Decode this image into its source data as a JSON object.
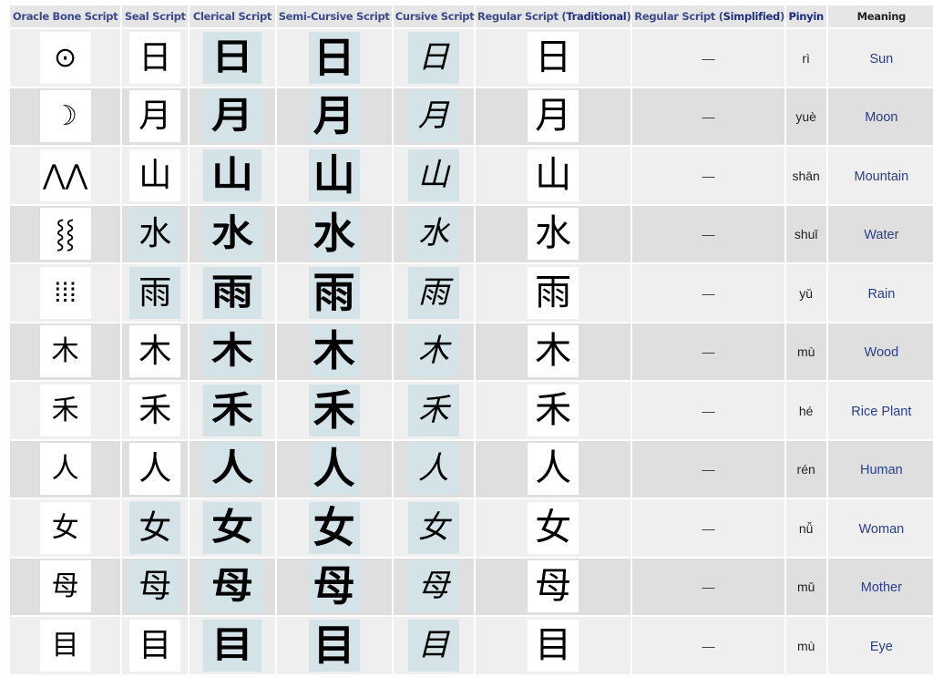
{
  "table": {
    "headers": [
      {
        "text": "Oracle Bone Script"
      },
      {
        "text": "Seal Script"
      },
      {
        "text": "Clerical Script"
      },
      {
        "text": "Semi-Cursive Script"
      },
      {
        "text": "Cursive Script"
      },
      {
        "prefix": "Regular Script (",
        "accent": "Traditional",
        "suffix": ")"
      },
      {
        "prefix": "Regular Script (",
        "accent": "Simplified",
        "suffix": ")"
      },
      {
        "text": "Pinyin"
      },
      {
        "text": "Meaning"
      }
    ],
    "rows": [
      {
        "oracle": "⊙",
        "seal": "日",
        "clerical": "日",
        "semi": "日",
        "cursive": "日",
        "traditional": "日",
        "simplified": "—",
        "pinyin": "rì",
        "meaning": "Sun",
        "seal_bg": "white"
      },
      {
        "oracle": "☽",
        "seal": "月",
        "clerical": "月",
        "semi": "月",
        "cursive": "月",
        "traditional": "月",
        "simplified": "—",
        "pinyin": "yuè",
        "meaning": "Moon",
        "seal_bg": "white"
      },
      {
        "oracle": "⋀⋀",
        "seal": "山",
        "clerical": "山",
        "semi": "山",
        "cursive": "山",
        "traditional": "山",
        "simplified": "—",
        "pinyin": "shān",
        "meaning": "Mountain",
        "seal_bg": "white"
      },
      {
        "oracle": "⸾⸾",
        "seal": "水",
        "clerical": "水",
        "semi": "水",
        "cursive": "水",
        "traditional": "水",
        "simplified": "—",
        "pinyin": "shuǐ",
        "meaning": "Water",
        "seal_bg": "blue"
      },
      {
        "oracle": "⁞⁞⁞",
        "seal": "雨",
        "clerical": "雨",
        "semi": "雨",
        "cursive": "雨",
        "traditional": "雨",
        "simplified": "—",
        "pinyin": "yǔ",
        "meaning": "Rain",
        "seal_bg": "blue"
      },
      {
        "oracle": "木",
        "seal": "木",
        "clerical": "木",
        "semi": "木",
        "cursive": "木",
        "traditional": "木",
        "simplified": "—",
        "pinyin": "mù",
        "meaning": "Wood",
        "seal_bg": "white"
      },
      {
        "oracle": "禾",
        "seal": "禾",
        "clerical": "禾",
        "semi": "禾",
        "cursive": "禾",
        "traditional": "禾",
        "simplified": "—",
        "pinyin": "hé",
        "meaning": "Rice Plant",
        "seal_bg": "white"
      },
      {
        "oracle": "人",
        "seal": "人",
        "clerical": "人",
        "semi": "人",
        "cursive": "人",
        "traditional": "人",
        "simplified": "—",
        "pinyin": "rén",
        "meaning": "Human",
        "seal_bg": "white"
      },
      {
        "oracle": "女",
        "seal": "女",
        "clerical": "女",
        "semi": "女",
        "cursive": "女",
        "traditional": "女",
        "simplified": "—",
        "pinyin": "nǚ",
        "meaning": "Woman",
        "seal_bg": "blue"
      },
      {
        "oracle": "母",
        "seal": "母",
        "clerical": "母",
        "semi": "母",
        "cursive": "母",
        "traditional": "母",
        "simplified": "—",
        "pinyin": "mǔ",
        "meaning": "Mother",
        "seal_bg": "blue"
      },
      {
        "oracle": "目",
        "seal": "目",
        "clerical": "目",
        "semi": "目",
        "cursive": "目",
        "traditional": "目",
        "simplified": "—",
        "pinyin": "mù",
        "meaning": "Eye",
        "seal_bg": "white"
      }
    ]
  }
}
